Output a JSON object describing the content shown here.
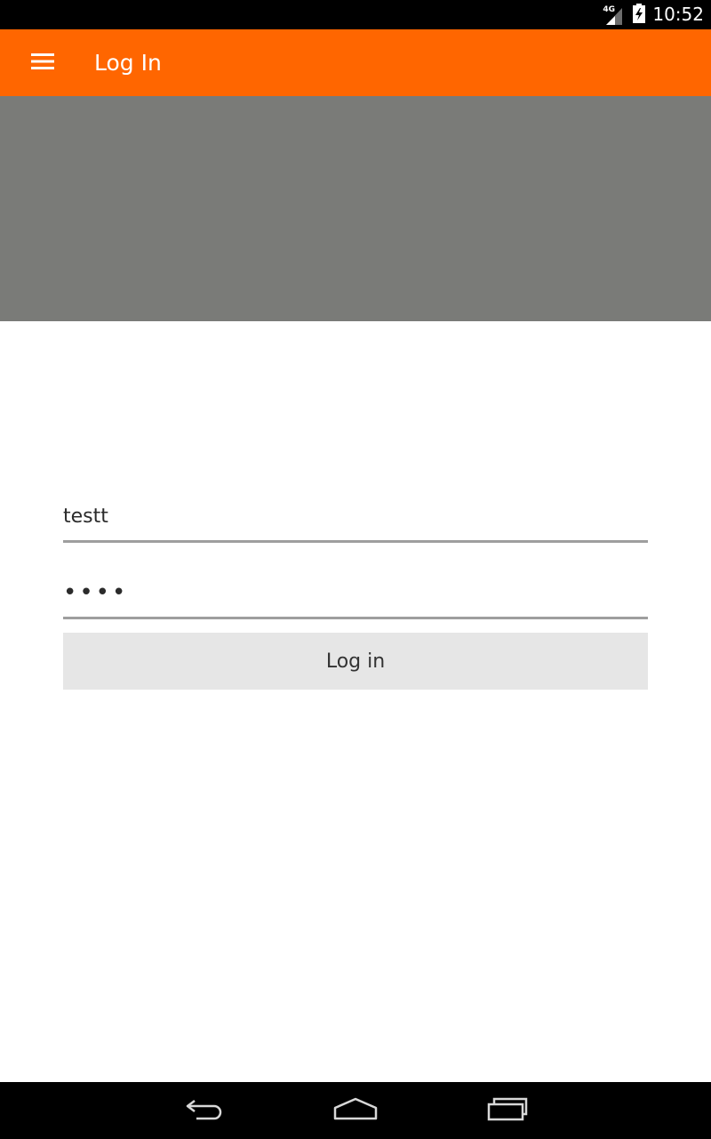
{
  "status_bar": {
    "network_type": "4G",
    "time": "10:52",
    "icons": [
      "signal-icon",
      "battery-icon"
    ]
  },
  "app_bar": {
    "title": "Log In",
    "menu_icon": "menu-icon",
    "background_color": "#ff6600"
  },
  "banner": {
    "background_color": "#7a7b78"
  },
  "login_form": {
    "username": {
      "value": "testt"
    },
    "password": {
      "value": "••••"
    },
    "submit_label": "Log in"
  },
  "nav_bar": {
    "icons": [
      "back-icon",
      "home-icon",
      "recents-icon"
    ]
  }
}
